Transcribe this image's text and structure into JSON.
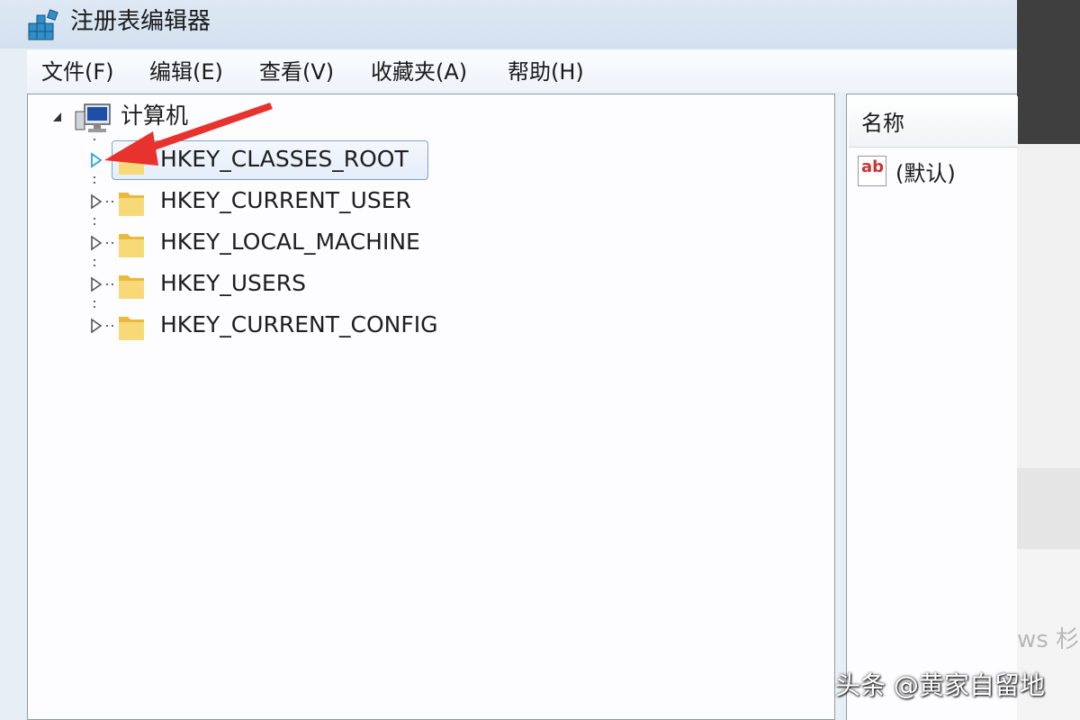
{
  "window": {
    "title": "注册表编辑器"
  },
  "menu": {
    "items": [
      "文件(F)",
      "编辑(E)",
      "查看(V)",
      "收藏夹(A)",
      "帮助(H)"
    ]
  },
  "tree": {
    "root_label": "计算机",
    "keys": [
      "HKEY_CLASSES_ROOT",
      "HKEY_CURRENT_USER",
      "HKEY_LOCAL_MACHINE",
      "HKEY_USERS",
      "HKEY_CURRENT_CONFIG"
    ],
    "selected_key": "HKEY_CLASSES_ROOT"
  },
  "values_pane": {
    "column_name": "名称",
    "rows": [
      {
        "icon": "ab-string-icon",
        "name": "(默认)"
      }
    ]
  },
  "overlay": {
    "annotation": "red-arrow-icon",
    "watermark": "头条 @黄家自留地",
    "background_fragment": "ws 杉"
  },
  "colors": {
    "arrow": "#e8322e",
    "selection_border": "#7da2ce",
    "folder": "#f2c94c",
    "expander_active": "#2aa7d6"
  }
}
